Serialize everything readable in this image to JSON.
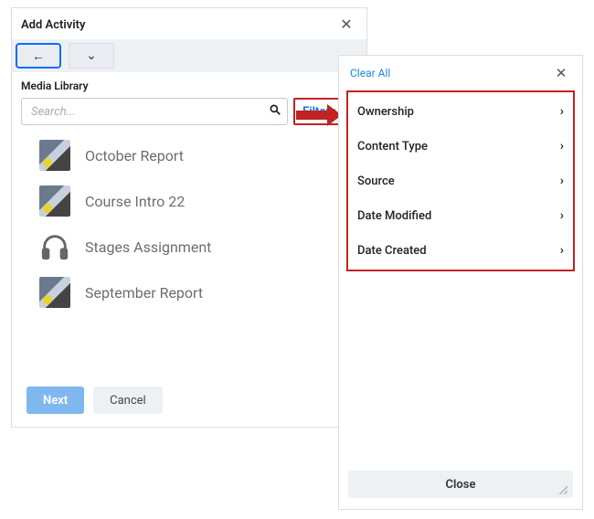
{
  "dialog": {
    "title": "Add Activity",
    "section_label": "Media Library",
    "search_placeholder": "Search...",
    "filters_label": "Filters",
    "next_label": "Next",
    "cancel_label": "Cancel"
  },
  "media_items": [
    {
      "title": "October Report",
      "kind": "image"
    },
    {
      "title": "Course Intro 22",
      "kind": "image"
    },
    {
      "title": "Stages Assignment",
      "kind": "audio"
    },
    {
      "title": "September Report",
      "kind": "image"
    }
  ],
  "filters_panel": {
    "clear_label": "Clear All",
    "close_label": "Close",
    "categories": [
      {
        "label": "Ownership"
      },
      {
        "label": "Content Type"
      },
      {
        "label": "Source"
      },
      {
        "label": "Date Modified"
      },
      {
        "label": "Date Created"
      }
    ]
  },
  "colors": {
    "callout_red": "#c02323",
    "accent_blue": "#0a6cff"
  }
}
